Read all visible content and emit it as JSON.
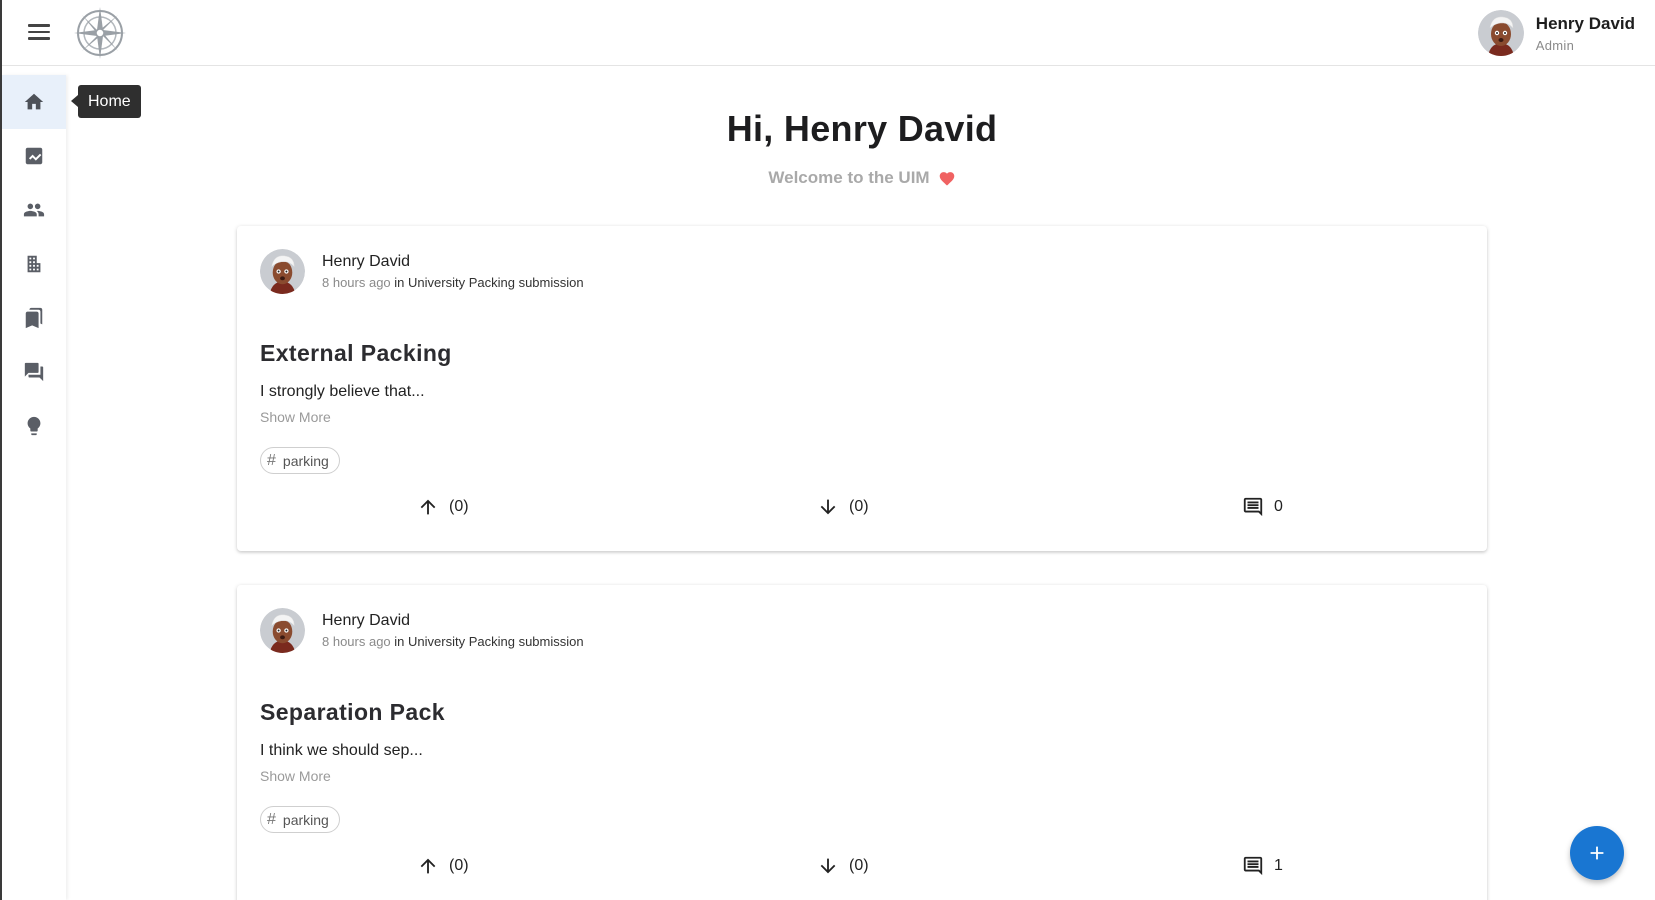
{
  "header": {
    "menu_icon": "hamburger-menu-icon",
    "logo": "compass-logo",
    "user_name": "Henry David",
    "user_role": "Admin"
  },
  "sidebar": {
    "items": [
      {
        "icon": "home-icon",
        "label": "Home",
        "active": true
      },
      {
        "icon": "insights-icon"
      },
      {
        "icon": "people-icon"
      },
      {
        "icon": "building-icon"
      },
      {
        "icon": "bookmarks-icon"
      },
      {
        "icon": "forum-icon"
      },
      {
        "icon": "lightbulb-icon"
      }
    ],
    "tooltip": "Home"
  },
  "greeting": {
    "title": "Hi, Henry David",
    "subtitle": "Welcome to the UIM",
    "heart_color": "#f06262"
  },
  "posts": [
    {
      "author": "Henry David",
      "ago": "8 hours ago",
      "context": "in University Packing submission",
      "title": "External Packing",
      "body": "I strongly believe that...",
      "show_more": "Show More",
      "tag": "parking",
      "upvotes": "(0)",
      "downvotes": "(0)",
      "comments": "0"
    },
    {
      "author": "Henry David",
      "ago": "8 hours ago",
      "context": "in University Packing submission",
      "title": "Separation Pack",
      "body": "I think we should sep...",
      "show_more": "Show More",
      "tag": "parking",
      "upvotes": "(0)",
      "downvotes": "(0)",
      "comments": "1"
    }
  ],
  "fab": {
    "icon": "plus-icon",
    "color": "#1976d2"
  },
  "colors": {
    "accent": "#1976d2",
    "active_nav_bg": "#e8f0fa",
    "tooltip_bg": "#2f2f2f"
  }
}
